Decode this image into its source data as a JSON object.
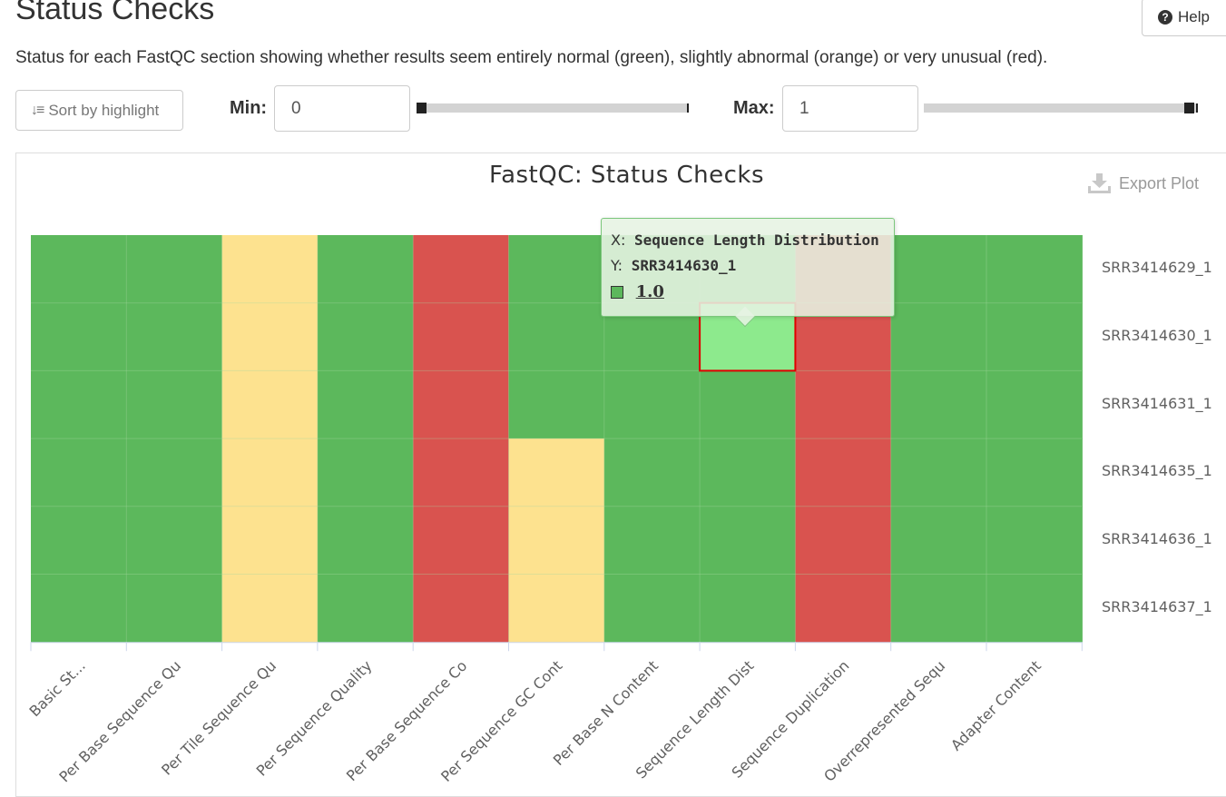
{
  "page": {
    "title": "Status Checks",
    "description": "Status for each FastQC section showing whether results seem entirely normal (green), slightly abnormal (orange) or very unusual (red)."
  },
  "toolbar": {
    "help_label": "Help",
    "sort_label": "Sort by highlight",
    "min_label": "Min:",
    "min_value": "0",
    "min_slider_value": 0,
    "max_label": "Max:",
    "max_value": "1",
    "max_slider_value": 1
  },
  "plot": {
    "export_label": "Export Plot"
  },
  "tooltip": {
    "x_key": "X:",
    "x_value": "Sequence Length Distribution",
    "y_key": "Y:",
    "y_value": "SRR3414630_1",
    "value": "1.0"
  },
  "colors": {
    "pass": "#5cb85c",
    "warn": "#fde28f",
    "fail": "#d9534f",
    "highlight": "#8dea8d",
    "highlight_border": "#e00000",
    "grid": "#a6d8a0"
  },
  "chart_data": {
    "type": "heatmap",
    "title": "FastQC: Status Checks",
    "x": [
      "Basic St...",
      "Per Base Sequence Qu",
      "Per Tile Sequence Qu",
      "Per Sequence Quality",
      "Per Base Sequence Co",
      "Per Sequence GC Cont",
      "Per Base N Content",
      "Sequence Length Dist",
      "Sequence Duplication",
      "Overrepresented Sequ",
      "Adapter Content"
    ],
    "y": [
      "SRR3414629_1",
      "SRR3414630_1",
      "SRR3414631_1",
      "SRR3414635_1",
      "SRR3414636_1",
      "SRR3414637_1"
    ],
    "status_scale": {
      "pass": 1,
      "warn": 0.5,
      "fail": 0.25
    },
    "values": [
      [
        1,
        1,
        0.5,
        1,
        0.25,
        1,
        1,
        1,
        0.25,
        1,
        1
      ],
      [
        1,
        1,
        0.5,
        1,
        0.25,
        1,
        1,
        1,
        0.25,
        1,
        1
      ],
      [
        1,
        1,
        0.5,
        1,
        0.25,
        1,
        1,
        1,
        0.25,
        1,
        1
      ],
      [
        1,
        1,
        0.5,
        1,
        0.25,
        0.5,
        1,
        1,
        0.25,
        1,
        1
      ],
      [
        1,
        1,
        0.5,
        1,
        0.25,
        0.5,
        1,
        1,
        0.25,
        1,
        1
      ],
      [
        1,
        1,
        0.5,
        1,
        0.25,
        0.5,
        1,
        1,
        0.25,
        1,
        1
      ]
    ],
    "highlighted_cell": {
      "x": "Sequence Length Dist",
      "y": "SRR3414630_1"
    }
  }
}
